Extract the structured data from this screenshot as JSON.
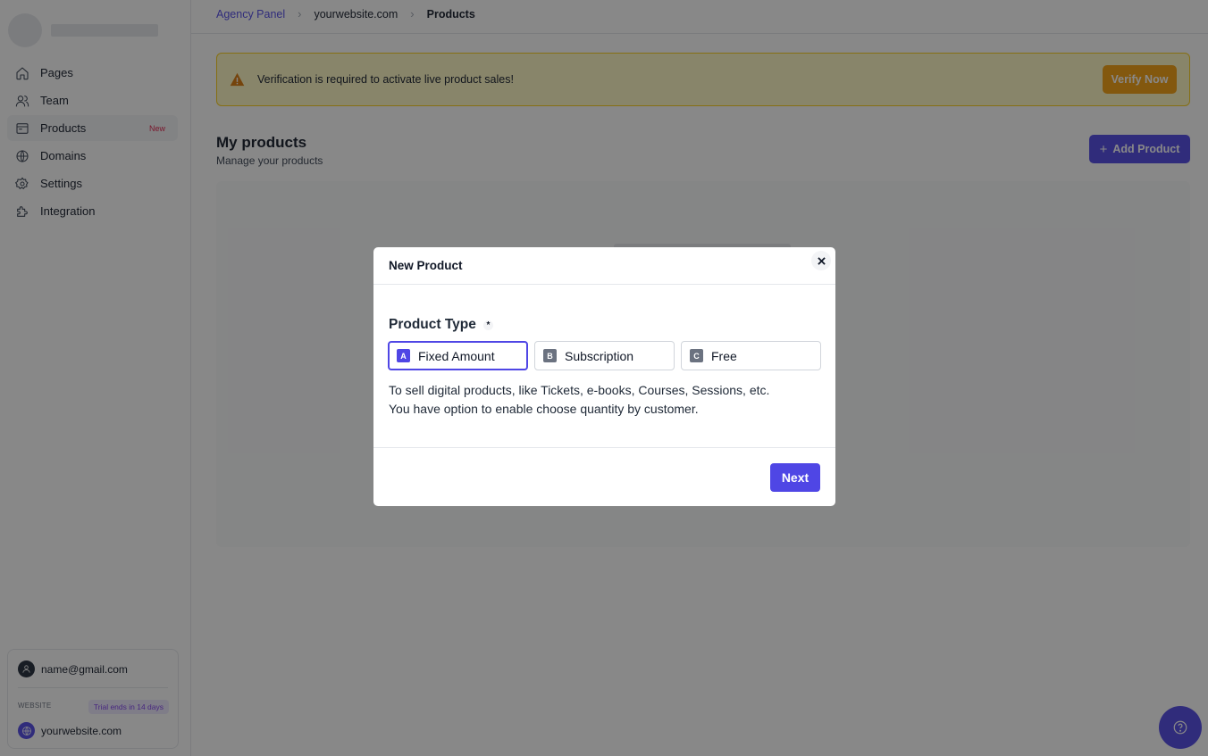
{
  "sidebar": {
    "items": [
      {
        "label": "Pages",
        "icon": "home-icon"
      },
      {
        "label": "Team",
        "icon": "users-icon"
      },
      {
        "label": "Products",
        "icon": "products-icon",
        "badge": "New",
        "active": true
      },
      {
        "label": "Domains",
        "icon": "globe-icon"
      },
      {
        "label": "Settings",
        "icon": "gear-icon"
      },
      {
        "label": "Integration",
        "icon": "puzzle-icon"
      }
    ],
    "account": {
      "email": "name@gmail.com",
      "website_label": "WEBSITE",
      "trial_badge": "Trial ends in 14 days",
      "website": "yourwebsite.com"
    }
  },
  "breadcrumb": {
    "items": [
      "Agency Panel",
      "yourwebsite.com",
      "Products"
    ]
  },
  "alert": {
    "text": "Verification is required to activate live product sales!",
    "button": "Verify Now"
  },
  "main": {
    "title": "My products",
    "subtitle": "Manage your products",
    "add_button": "Add Product"
  },
  "modal": {
    "title": "New Product",
    "field_label": "Product Type",
    "required_mark": "*",
    "options": [
      {
        "key": "A",
        "label": "Fixed Amount",
        "selected": true
      },
      {
        "key": "B",
        "label": "Subscription",
        "selected": false
      },
      {
        "key": "C",
        "label": "Free",
        "selected": false
      }
    ],
    "description_line1": "To sell digital products, like Tickets, e-books, Courses, Sessions, etc.",
    "description_line2": "You have option to enable choose quantity by customer.",
    "next_button": "Next"
  },
  "colors": {
    "accent": "#4f46e5",
    "warning_bg": "#fef9c3",
    "warning_button": "#f59e0b",
    "badge_new": "#e11d48"
  }
}
